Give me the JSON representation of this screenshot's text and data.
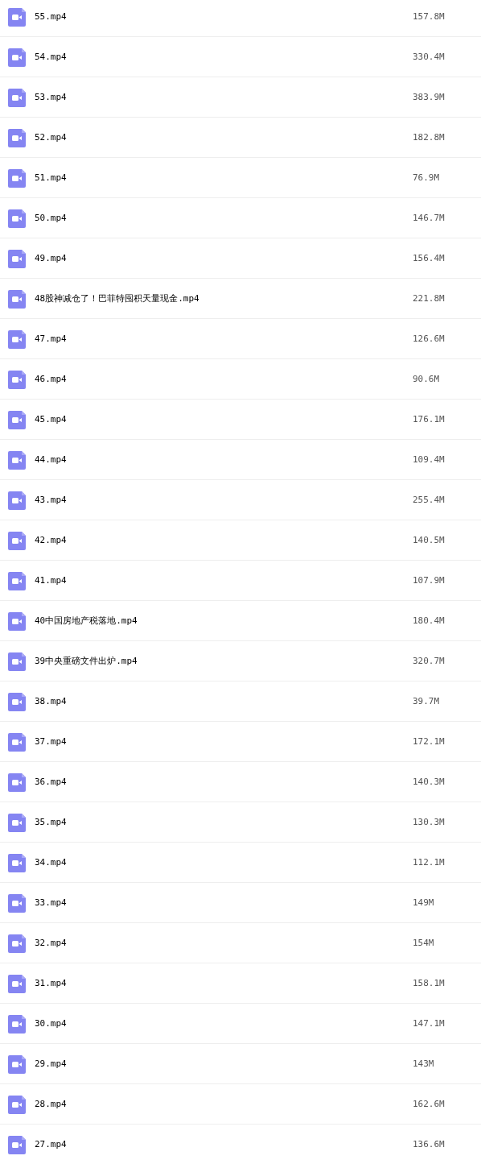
{
  "files": [
    {
      "name": "55.mp4",
      "size": "157.8M"
    },
    {
      "name": "54.mp4",
      "size": "330.4M"
    },
    {
      "name": "53.mp4",
      "size": "383.9M"
    },
    {
      "name": "52.mp4",
      "size": "182.8M"
    },
    {
      "name": "51.mp4",
      "size": "76.9M"
    },
    {
      "name": "50.mp4",
      "size": "146.7M"
    },
    {
      "name": "49.mp4",
      "size": "156.4M"
    },
    {
      "name": "48股神减仓了！巴菲特囤积天量现金.mp4",
      "size": "221.8M"
    },
    {
      "name": "47.mp4",
      "size": "126.6M"
    },
    {
      "name": "46.mp4",
      "size": "90.6M"
    },
    {
      "name": "45.mp4",
      "size": "176.1M"
    },
    {
      "name": "44.mp4",
      "size": "109.4M"
    },
    {
      "name": "43.mp4",
      "size": "255.4M"
    },
    {
      "name": "42.mp4",
      "size": "140.5M"
    },
    {
      "name": "41.mp4",
      "size": "107.9M"
    },
    {
      "name": "40中国房地产税落地.mp4",
      "size": "180.4M"
    },
    {
      "name": "39中央重磅文件出炉.mp4",
      "size": "320.7M"
    },
    {
      "name": "38.mp4",
      "size": "39.7M"
    },
    {
      "name": "37.mp4",
      "size": "172.1M"
    },
    {
      "name": "36.mp4",
      "size": "140.3M"
    },
    {
      "name": "35.mp4",
      "size": "130.3M"
    },
    {
      "name": "34.mp4",
      "size": "112.1M"
    },
    {
      "name": "33.mp4",
      "size": "149M"
    },
    {
      "name": "32.mp4",
      "size": "154M"
    },
    {
      "name": "31.mp4",
      "size": "158.1M"
    },
    {
      "name": "30.mp4",
      "size": "147.1M"
    },
    {
      "name": "29.mp4",
      "size": "143M"
    },
    {
      "name": "28.mp4",
      "size": "162.6M"
    },
    {
      "name": "27.mp4",
      "size": "136.6M"
    }
  ]
}
